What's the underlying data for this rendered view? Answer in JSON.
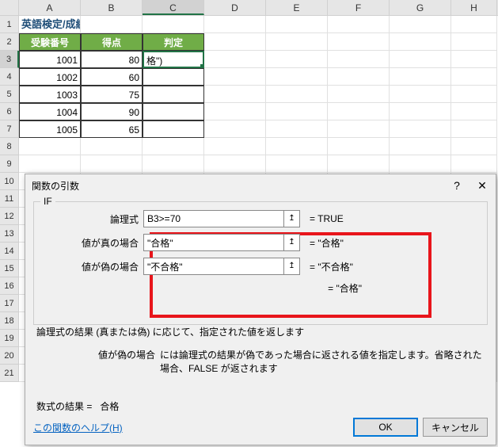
{
  "columns": [
    "A",
    "B",
    "C",
    "D",
    "E",
    "F",
    "G",
    "H"
  ],
  "rowNumbers": [
    "1",
    "2",
    "3",
    "4",
    "5",
    "6",
    "7",
    "8",
    "9",
    "10",
    "11",
    "12",
    "13",
    "14",
    "15",
    "16",
    "17",
    "18",
    "19",
    "20",
    "21"
  ],
  "title": "英語検定/成績評価",
  "headers": {
    "exam": "受験番号",
    "score": "得点",
    "result": "判定"
  },
  "data": [
    {
      "id": "1001",
      "score": "80",
      "formula": "格\")"
    },
    {
      "id": "1002",
      "score": "60"
    },
    {
      "id": "1003",
      "score": "75"
    },
    {
      "id": "1004",
      "score": "90"
    },
    {
      "id": "1005",
      "score": "65"
    }
  ],
  "dialog": {
    "title": "関数の引数",
    "fn": "IF",
    "labels": {
      "logical": "論理式",
      "true": "値が真の場合",
      "false": "値が偽の場合"
    },
    "inputs": {
      "logical": "B3>=70",
      "true": "\"合格\"",
      "false": "\"不合格\""
    },
    "evals": {
      "logical": "=   TRUE",
      "true": "=   \"合格\"",
      "false": "=   \"不合格\""
    },
    "refIcon": "↥",
    "preview": "=   \"合格\"",
    "desc1": "論理式の結果 (真または偽) に応じて、指定された値を返します",
    "desc2label": "値が偽の場合",
    "desc2": "には論理式の結果が偽であった場合に返される値を指定します。省略された場合、FALSE が返されます",
    "resultLabel": "数式の結果 =",
    "resultValue": "合格",
    "helpLink": "この関数のヘルプ(H)",
    "ok": "OK",
    "cancel": "キャンセル",
    "helpBtn": "?",
    "closeBtn": "✕"
  }
}
